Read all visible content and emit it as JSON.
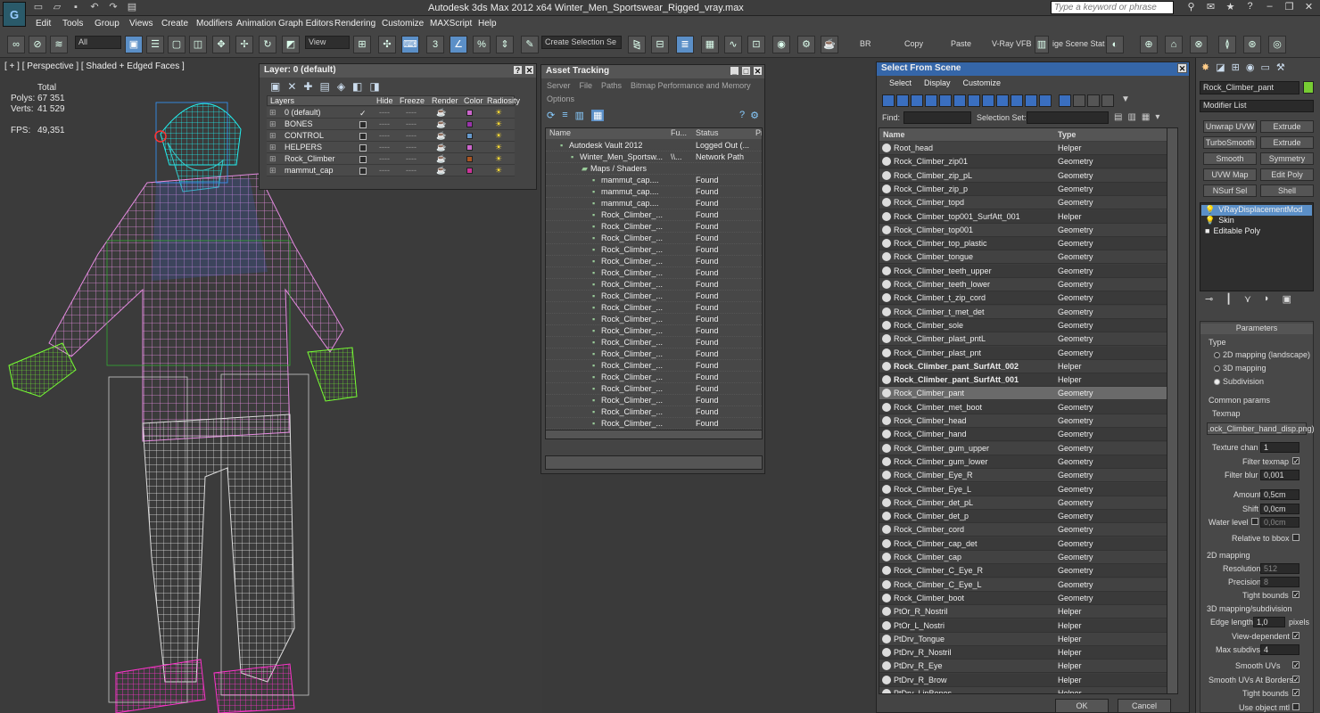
{
  "app": {
    "title": "Autodesk 3ds Max  2012 x64     Winter_Men_Sportswear_Rigged_vray.max",
    "search_placeholder": "Type a keyword or phrase",
    "logo": "3ds-max-logo"
  },
  "menu": [
    "Edit",
    "Tools",
    "Group",
    "Views",
    "Create",
    "Modifiers",
    "Animation",
    "Graph Editors",
    "Rendering",
    "Customize",
    "MAXScript",
    "Help"
  ],
  "toolbar": {
    "filter_value": "All",
    "view_value": "View",
    "selection_set": "Create Selection Se",
    "render_label": "BR",
    "copy_label": "Copy",
    "paste_label": "Paste",
    "vray_label": "V-Ray VFB",
    "scene_label": "ige Scene Stat"
  },
  "viewport": {
    "label": "[ + ] [ Perspective ] [ Shaded + Edged Faces ]",
    "stats": {
      "total_label": "Total",
      "polys_label": "Polys:",
      "polys_value": "67 351",
      "verts_label": "Verts:",
      "verts_value": "41 529",
      "fps_label": "FPS:",
      "fps_value": "49,351"
    }
  },
  "layers_panel": {
    "title": "Layer: 0 (default)",
    "columns": [
      "Layers",
      "Hide",
      "Freeze",
      "Render",
      "Color",
      "Radiosity"
    ],
    "rows": [
      {
        "name": "0 (default)",
        "color": "#cc66cc"
      },
      {
        "name": "BONES",
        "color": "#9933aa"
      },
      {
        "name": "CONTROL",
        "color": "#6699cc"
      },
      {
        "name": "HELPERS",
        "color": "#cc66cc"
      },
      {
        "name": "Rock_Climber",
        "color": "#aa5522"
      },
      {
        "name": "mammut_cap",
        "color": "#cc3399"
      }
    ]
  },
  "asset_panel": {
    "title": "Asset Tracking",
    "menu": [
      "Server",
      "File",
      "Paths",
      "Bitmap Performance and Memory"
    ],
    "options_label": "Options",
    "columns": [
      "Name",
      "Fu...",
      "Status",
      "Pr"
    ],
    "rows": [
      {
        "name": "Autodesk Vault 2012",
        "fu": "",
        "status": "Logged Out (...",
        "indent": 1
      },
      {
        "name": "Winter_Men_Sportsw...",
        "fu": "\\\\...",
        "status": "Network Path",
        "indent": 2
      },
      {
        "name": "Maps / Shaders",
        "fu": "",
        "status": "",
        "indent": 3
      },
      {
        "name": "mammut_cap....",
        "fu": "",
        "status": "Found",
        "indent": 4
      },
      {
        "name": "mammut_cap....",
        "fu": "",
        "status": "Found",
        "indent": 4
      },
      {
        "name": "mammut_cap....",
        "fu": "",
        "status": "Found",
        "indent": 4
      },
      {
        "name": "Rock_Climber_...",
        "fu": "",
        "status": "Found",
        "indent": 4
      },
      {
        "name": "Rock_Climber_...",
        "fu": "",
        "status": "Found",
        "indent": 4
      },
      {
        "name": "Rock_Climber_...",
        "fu": "",
        "status": "Found",
        "indent": 4
      },
      {
        "name": "Rock_Climber_...",
        "fu": "",
        "status": "Found",
        "indent": 4
      },
      {
        "name": "Rock_Climber_...",
        "fu": "",
        "status": "Found",
        "indent": 4
      },
      {
        "name": "Rock_Climber_...",
        "fu": "",
        "status": "Found",
        "indent": 4
      },
      {
        "name": "Rock_Climber_...",
        "fu": "",
        "status": "Found",
        "indent": 4
      },
      {
        "name": "Rock_Climber_...",
        "fu": "",
        "status": "Found",
        "indent": 4
      },
      {
        "name": "Rock_Climber_...",
        "fu": "",
        "status": "Found",
        "indent": 4
      },
      {
        "name": "Rock_Climber_...",
        "fu": "",
        "status": "Found",
        "indent": 4
      },
      {
        "name": "Rock_Climber_...",
        "fu": "",
        "status": "Found",
        "indent": 4
      },
      {
        "name": "Rock_Climber_...",
        "fu": "",
        "status": "Found",
        "indent": 4
      },
      {
        "name": "Rock_Climber_...",
        "fu": "",
        "status": "Found",
        "indent": 4
      },
      {
        "name": "Rock_Climber_...",
        "fu": "",
        "status": "Found",
        "indent": 4
      },
      {
        "name": "Rock_Climber_...",
        "fu": "",
        "status": "Found",
        "indent": 4
      },
      {
        "name": "Rock_Climber_...",
        "fu": "",
        "status": "Found",
        "indent": 4
      },
      {
        "name": "Rock_Climber_...",
        "fu": "",
        "status": "Found",
        "indent": 4
      },
      {
        "name": "Rock_Climber_...",
        "fu": "",
        "status": "Found",
        "indent": 4
      },
      {
        "name": "Rock_Climber_...",
        "fu": "",
        "status": "Found",
        "indent": 4
      }
    ]
  },
  "select_panel": {
    "title": "Select From Scene",
    "menu": [
      "Select",
      "Display",
      "Customize"
    ],
    "find_label": "Find:",
    "selset_label": "Selection Set:",
    "columns": [
      "Name",
      "Type"
    ],
    "ok_label": "OK",
    "cancel_label": "Cancel",
    "rows": [
      {
        "name": "Root_head",
        "type": "Helper"
      },
      {
        "name": "Rock_Climber_zip01",
        "type": "Geometry"
      },
      {
        "name": "Rock_Climber_zip_pL",
        "type": "Geometry"
      },
      {
        "name": "Rock_Climber_zip_p",
        "type": "Geometry"
      },
      {
        "name": "Rock_Climber_topd",
        "type": "Geometry"
      },
      {
        "name": "Rock_Climber_top001_SurfAtt_001",
        "type": "Helper"
      },
      {
        "name": "Rock_Climber_top001",
        "type": "Geometry"
      },
      {
        "name": "Rock_Climber_top_plastic",
        "type": "Geometry"
      },
      {
        "name": "Rock_Climber_tongue",
        "type": "Geometry"
      },
      {
        "name": "Rock_Climber_teeth_upper",
        "type": "Geometry"
      },
      {
        "name": "Rock_Climber_teeth_lower",
        "type": "Geometry"
      },
      {
        "name": "Rock_Climber_t_zip_cord",
        "type": "Geometry"
      },
      {
        "name": "Rock_Climber_t_met_det",
        "type": "Geometry"
      },
      {
        "name": "Rock_Climber_sole",
        "type": "Geometry"
      },
      {
        "name": "Rock_Climber_plast_pntL",
        "type": "Geometry"
      },
      {
        "name": "Rock_Climber_plast_pnt",
        "type": "Geometry"
      },
      {
        "name": "Rock_Climber_pant_SurfAtt_002",
        "type": "Helper",
        "bold": true
      },
      {
        "name": "Rock_Climber_pant_SurfAtt_001",
        "type": "Helper",
        "bold": true
      },
      {
        "name": "Rock_Climber_pant",
        "type": "Geometry",
        "selected": true
      },
      {
        "name": "Rock_Climber_met_boot",
        "type": "Geometry"
      },
      {
        "name": "Rock_Climber_head",
        "type": "Geometry"
      },
      {
        "name": "Rock_Climber_hand",
        "type": "Geometry"
      },
      {
        "name": "Rock_Climber_gum_upper",
        "type": "Geometry"
      },
      {
        "name": "Rock_Climber_gum_lower",
        "type": "Geometry"
      },
      {
        "name": "Rock_Climber_Eye_R",
        "type": "Geometry"
      },
      {
        "name": "Rock_Climber_Eye_L",
        "type": "Geometry"
      },
      {
        "name": "Rock_Climber_det_pL",
        "type": "Geometry"
      },
      {
        "name": "Rock_Climber_det_p",
        "type": "Geometry"
      },
      {
        "name": "Rock_Climber_cord",
        "type": "Geometry"
      },
      {
        "name": "Rock_Climber_cap_det",
        "type": "Geometry"
      },
      {
        "name": "Rock_Climber_cap",
        "type": "Geometry"
      },
      {
        "name": "Rock_Climber_C_Eye_R",
        "type": "Geometry"
      },
      {
        "name": "Rock_Climber_C_Eye_L",
        "type": "Geometry"
      },
      {
        "name": "Rock_Climber_boot",
        "type": "Geometry"
      },
      {
        "name": "PtOr_R_Nostril",
        "type": "Helper"
      },
      {
        "name": "PtOr_L_Nostri",
        "type": "Helper"
      },
      {
        "name": "PtDrv_Tongue",
        "type": "Helper"
      },
      {
        "name": "PtDrv_R_Nostril",
        "type": "Helper"
      },
      {
        "name": "PtDrv_R_Eye",
        "type": "Helper"
      },
      {
        "name": "PtDrv_R_Brow",
        "type": "Helper"
      },
      {
        "name": "PtDrv_LipBones",
        "type": "Helper"
      }
    ]
  },
  "command_panel": {
    "object_name": "Rock_Climber_pant",
    "modifier_list": "Modifier List",
    "buttons": [
      [
        "Unwrap UVW",
        "Extrude"
      ],
      [
        "TurboSmooth",
        "Extrude"
      ],
      [
        "Smooth",
        "Symmetry"
      ],
      [
        "UVW Map",
        "Edit Poly"
      ],
      [
        "NSurf Sel",
        "Shell"
      ]
    ],
    "stack": [
      {
        "name": "VRayDisplacementMod",
        "selected": true
      },
      {
        "name": "Skin",
        "selected": false
      },
      {
        "name": "Editable Poly",
        "selected": false
      }
    ],
    "params": {
      "rollout": "Parameters",
      "type_label": "Type",
      "type_options": [
        "2D mapping (landscape)",
        "3D mapping",
        "Subdivision"
      ],
      "type_selected": 2,
      "common_label": "Common params",
      "texmap_label": "Texmap",
      "texmap_value": ".ock_Climber_hand_disp.png)",
      "texchan_label": "Texture chan",
      "texchan_value": "1",
      "filter_label": "Filter texmap",
      "filterblur_label": "Filter blur",
      "filterblur_value": "0,001",
      "amount_label": "Amount",
      "amount_value": "0,5cm",
      "shift_label": "Shift",
      "shift_value": "0,0cm",
      "water_label": "Water level",
      "water_value": "0,0cm",
      "relbbox_label": "Relative to bbox",
      "map2d_label": "2D mapping",
      "res_label": "Resolution",
      "res_value": "512",
      "prec_label": "Precision",
      "prec_value": "8",
      "tight_label": "Tight bounds",
      "map3d_label": "3D mapping/subdivision",
      "edge_label": "Edge length",
      "edge_value": "1,0",
      "pixels_label": "pixels",
      "viewdep_label": "View-dependent",
      "maxsub_label": "Max subdivs",
      "maxsub_value": "4",
      "smoothuv_label": "Smooth UVs",
      "smoothuvb_label": "Smooth UVs At Borders",
      "tight2_label": "Tight bounds",
      "useobj_label": "Use object mtl"
    }
  }
}
